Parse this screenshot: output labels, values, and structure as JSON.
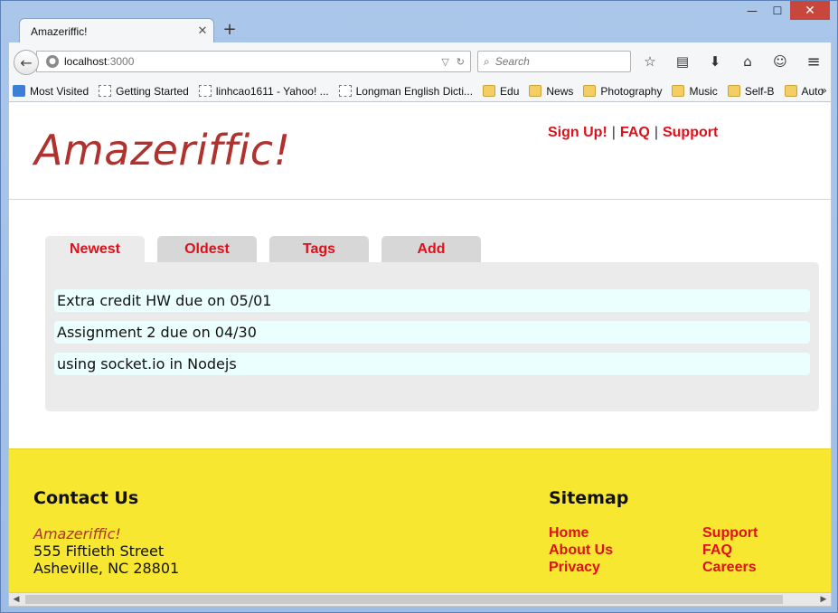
{
  "browser": {
    "tab_title": "Amazeriffic!",
    "url_host": "localhost",
    "url_port": ":3000",
    "search_placeholder": "Search",
    "window_controls": {
      "minimize": "—",
      "maximize": "☐",
      "close": "✕"
    },
    "bookmarks": [
      {
        "label": "Most Visited",
        "icon": "special"
      },
      {
        "label": "Getting Started",
        "icon": "page"
      },
      {
        "label": "linhcao1611 - Yahoo! ...",
        "icon": "page"
      },
      {
        "label": "Longman English Dicti...",
        "icon": "page"
      },
      {
        "label": "Edu",
        "icon": "folder"
      },
      {
        "label": "News",
        "icon": "folder"
      },
      {
        "label": "Photography",
        "icon": "folder"
      },
      {
        "label": "Music",
        "icon": "folder"
      },
      {
        "label": "Self-B",
        "icon": "folder"
      },
      {
        "label": "Auto",
        "icon": "folder"
      }
    ],
    "bookmarks_more": "»"
  },
  "site": {
    "logo": "Amazeriffic!",
    "top_nav": {
      "signup": "Sign Up!",
      "faq": "FAQ",
      "support": "Support",
      "separator": "|"
    },
    "tabs": [
      "Newest",
      "Oldest",
      "Tags",
      "Add"
    ],
    "active_tab": "Newest",
    "todos": [
      "Extra credit HW due on 05/01",
      "Assignment 2 due on 04/30",
      "using socket.io in Nodejs"
    ],
    "footer": {
      "contact_heading": "Contact Us",
      "contact_name": "Amazeriffic!",
      "address_line1": "555 Fiftieth Street",
      "address_line2": "Asheville, NC 28801",
      "sitemap_heading": "Sitemap",
      "sitemap_left": [
        "Home",
        "About Us",
        "Privacy"
      ],
      "sitemap_right": [
        "Support",
        "FAQ",
        "Careers"
      ]
    }
  },
  "colors": {
    "accent_red": "#e0101a",
    "logo_red": "#b0312e",
    "footer_yellow": "#f7e731",
    "todo_bg": "#eafffe"
  }
}
